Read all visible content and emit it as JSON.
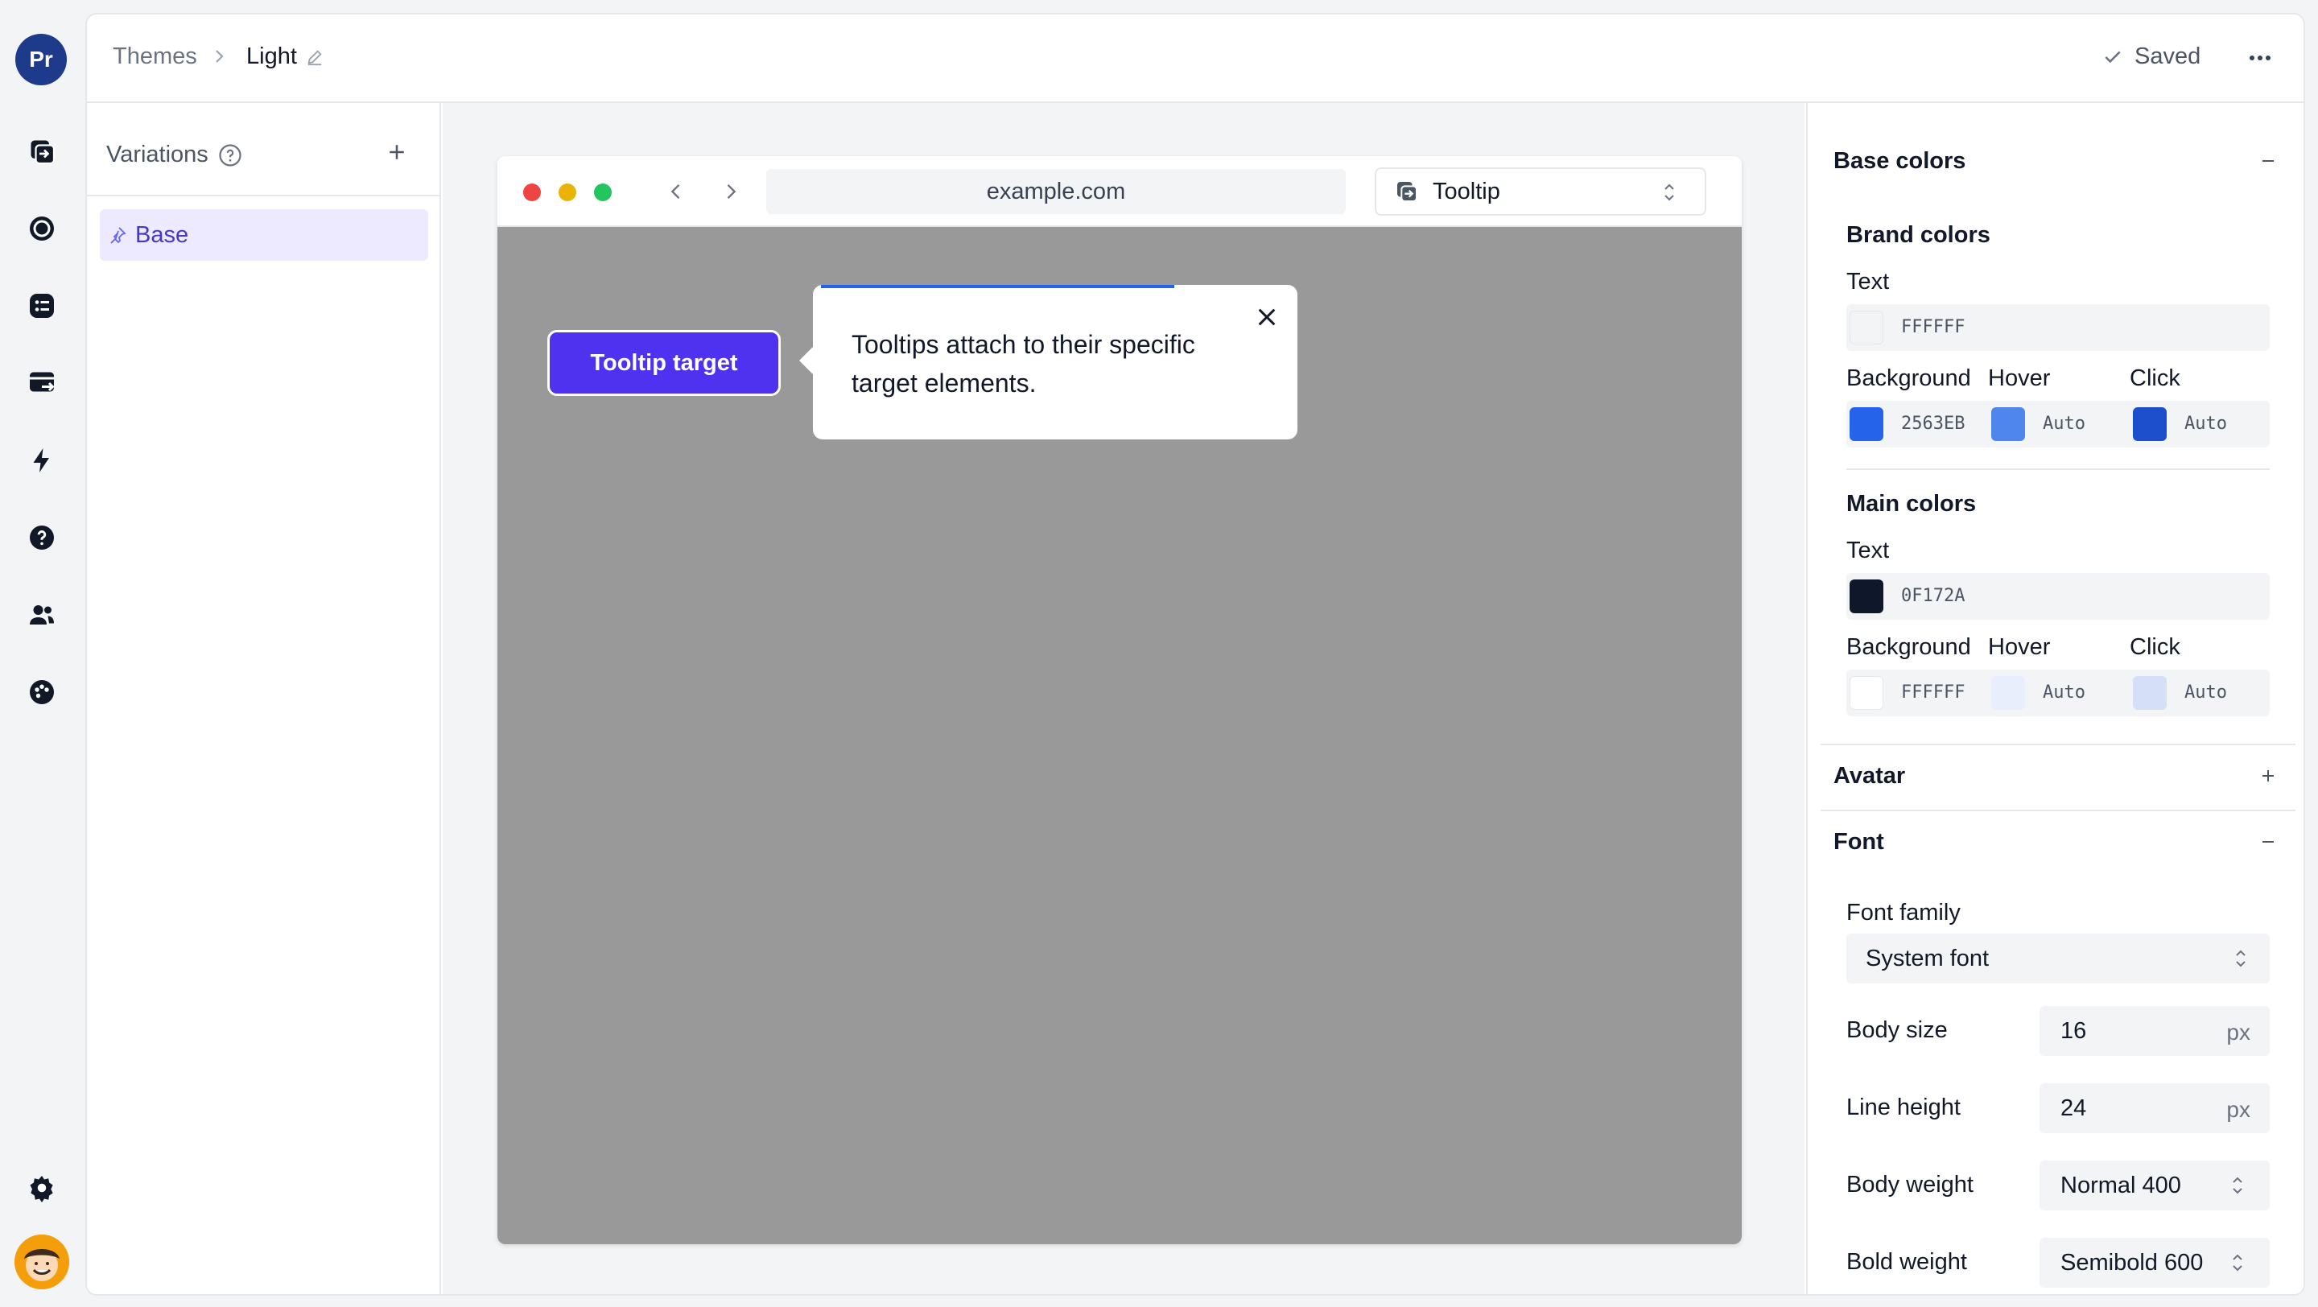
{
  "app": {
    "logo_text": "Pr"
  },
  "rail": {
    "icons": [
      "screen-share-icon",
      "record-icon",
      "list-icon",
      "card-exit-icon",
      "lightning-icon",
      "help-icon",
      "users-icon",
      "palette-icon",
      "settings-icon"
    ]
  },
  "breadcrumb": {
    "parent": "Themes",
    "current": "Light"
  },
  "status": {
    "saved": "Saved"
  },
  "variations": {
    "title": "Variations",
    "items": [
      {
        "label": "Base"
      }
    ]
  },
  "browser": {
    "url": "example.com",
    "component_select": "Tooltip"
  },
  "preview": {
    "target_label": "Tooltip target",
    "tooltip_text": "Tooltips attach to their specific target elements.",
    "tooltip_progress": 0.73
  },
  "settings": {
    "base_colors": {
      "title": "Base colors",
      "brand": {
        "title": "Brand colors",
        "text_label": "Text",
        "text_hex": "FFFFFF",
        "background_label": "Background",
        "hover_label": "Hover",
        "click_label": "Click",
        "background_hex": "2563EB",
        "hover_value": "Auto",
        "click_value": "Auto",
        "colors": {
          "text": "#FFFFFF",
          "background": "#2563EB",
          "hover": "#4F86EE",
          "click": "#1D4FCC"
        }
      },
      "main": {
        "title": "Main colors",
        "text_label": "Text",
        "text_hex": "0F172A",
        "background_label": "Background",
        "hover_label": "Hover",
        "click_label": "Click",
        "background_hex": "FFFFFF",
        "hover_value": "Auto",
        "click_value": "Auto",
        "colors": {
          "text": "#0F172A",
          "background": "#FFFFFF",
          "hover": "#E8EEFB",
          "click": "#D5DFF8"
        }
      }
    },
    "avatar": {
      "title": "Avatar"
    },
    "font": {
      "title": "Font",
      "family_label": "Font family",
      "family_value": "System font",
      "body_size_label": "Body size",
      "body_size_value": "16",
      "body_size_unit": "px",
      "line_height_label": "Line height",
      "line_height_value": "24",
      "line_height_unit": "px",
      "body_weight_label": "Body weight",
      "body_weight_value": "Normal 400",
      "bold_weight_label": "Bold weight",
      "bold_weight_value": "Semibold 600"
    }
  },
  "colors": {
    "accent": "#4F32F0",
    "brand_blue": "#2563EB",
    "logo_bg": "#1E3A8A"
  }
}
